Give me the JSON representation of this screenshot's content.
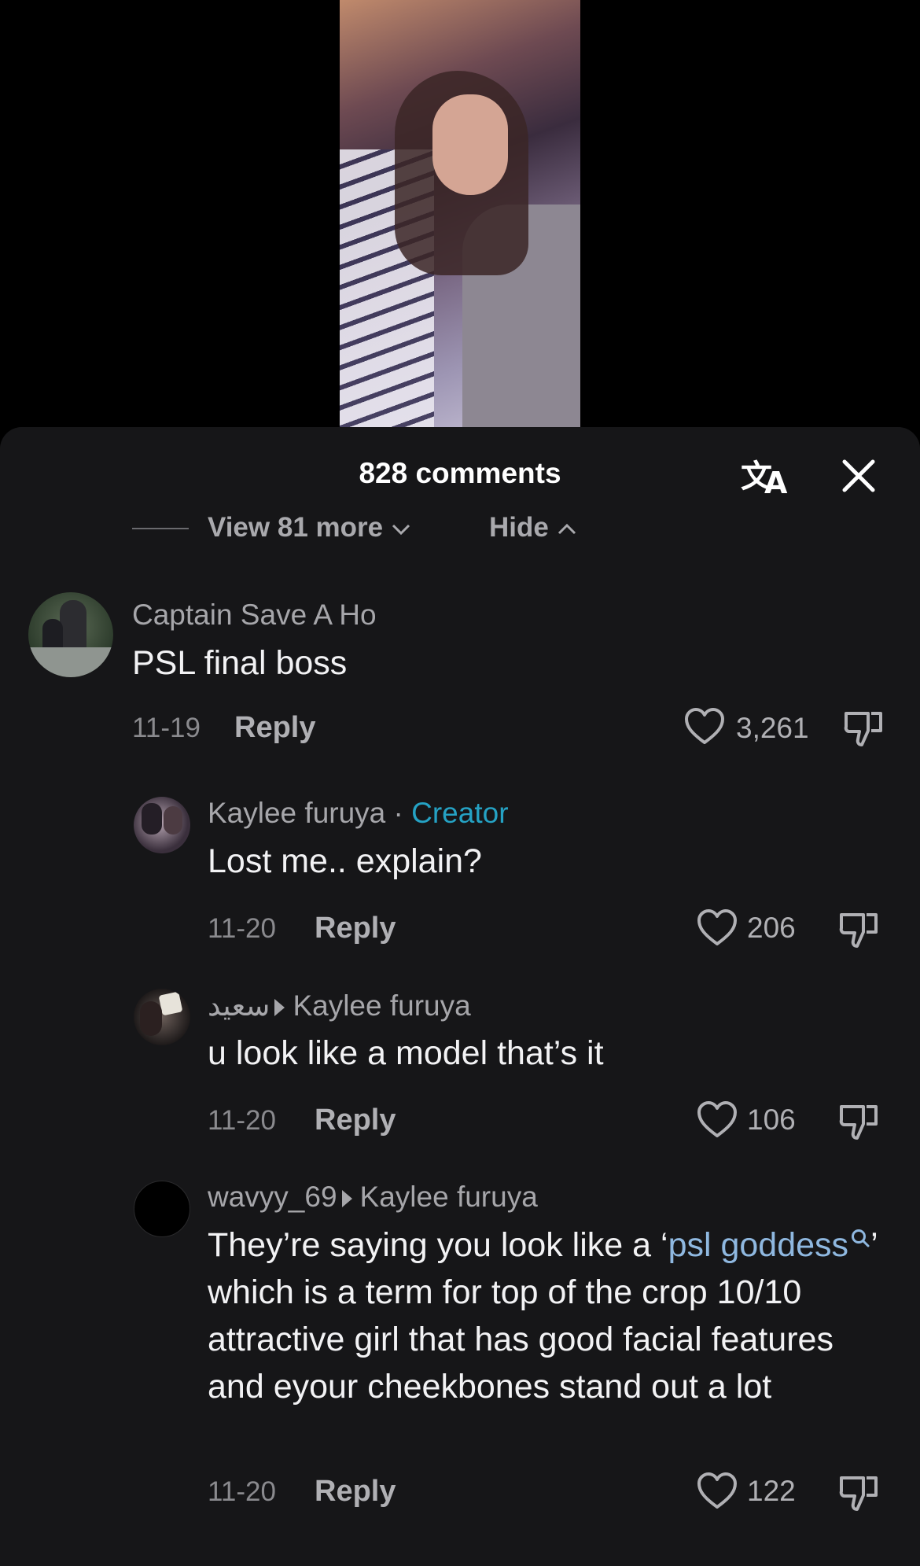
{
  "header": {
    "title": "828 comments"
  },
  "thread": {
    "view_more_label": "View 81 more",
    "hide_label": "Hide"
  },
  "comments": [
    {
      "username": "Captain Save A Ho",
      "text": "PSL final boss",
      "date": "11-19",
      "reply_label": "Reply",
      "likes": "3,261"
    },
    {
      "username": "Kaylee furuya",
      "separator": " · ",
      "badge": "Creator",
      "text": "Lost me.. explain?",
      "date": "11-20",
      "reply_label": "Reply",
      "likes": "206"
    },
    {
      "username": "سعيد",
      "reply_to": "Kaylee furuya",
      "text": "u look like a model that’s it",
      "date": "11-20",
      "reply_label": "Reply",
      "likes": "106"
    },
    {
      "username": "wavyy_69",
      "reply_to": "Kaylee furuya",
      "text_before": "They’re saying you look like a ‘",
      "link_text": "psl goddess",
      "text_after": "’ which is a term for top of the crop 10/10 attractive girl that has good facial features and eyour cheekbones stand out a lot",
      "date": "11-20",
      "reply_label": "Reply",
      "likes": "122"
    }
  ],
  "colors": {
    "sheet_bg": "#161618",
    "creator_badge": "#25a2c4",
    "link": "#8fb8e0"
  },
  "icons": [
    "translate-icon",
    "close-icon",
    "chevron-down-icon",
    "chevron-up-icon",
    "heart-icon",
    "dislike-icon",
    "search-icon"
  ]
}
